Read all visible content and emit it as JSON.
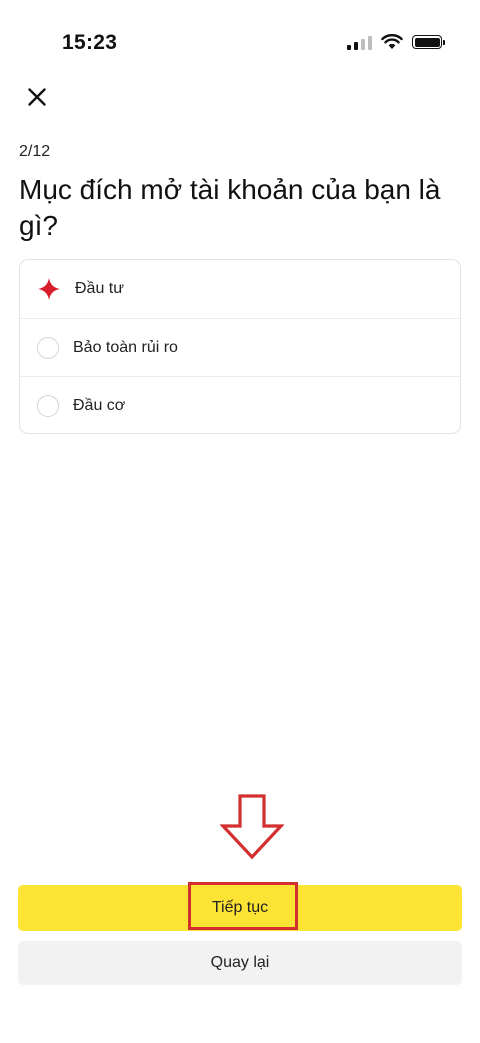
{
  "status_bar": {
    "time": "15:23",
    "icons": [
      "signal-icon",
      "wifi-icon",
      "battery-icon"
    ]
  },
  "header": {
    "close_icon": "close-icon"
  },
  "survey": {
    "step": "2/12",
    "question": "Mục đích mở tài khoản của bạn là gì?",
    "options": [
      {
        "label": "Đầu tư",
        "selected": true
      },
      {
        "label": "Bảo toàn rủi ro",
        "selected": false
      },
      {
        "label": "Đầu cơ",
        "selected": false
      }
    ]
  },
  "actions": {
    "continue_label": "Tiếp tục",
    "back_label": "Quay lại"
  },
  "colors": {
    "primary_button": "#fde334",
    "secondary_button": "#f2f2f2",
    "selected_radio": "#d81e2c",
    "annotation": "#d32f2f"
  }
}
